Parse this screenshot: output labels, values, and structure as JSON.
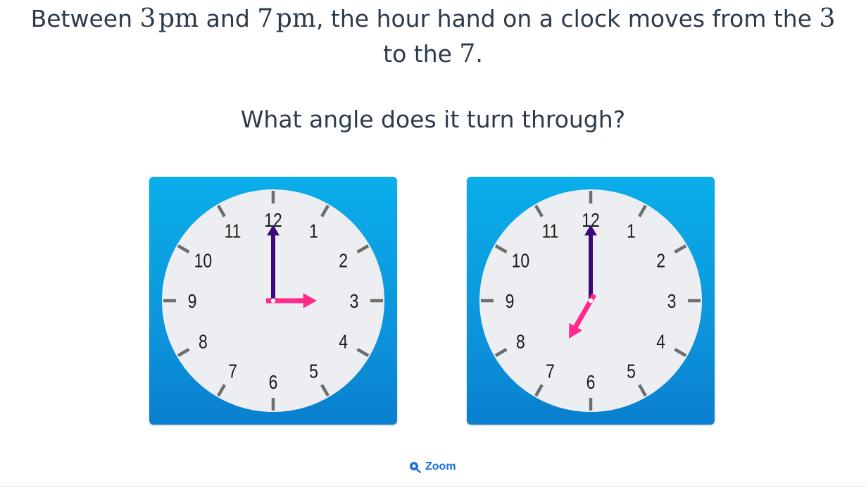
{
  "prompt": {
    "line1": {
      "part1": "Between ",
      "m1": "3",
      "m1_unit": "pm",
      "part2": " and ",
      "m2": "7",
      "m2_unit": "pm",
      "part3": ", the hour hand on a clock moves from the ",
      "m3": "3"
    },
    "line2": {
      "part1": "to the ",
      "m1": "7",
      "part2": "."
    },
    "question": "What angle does it turn through?"
  },
  "clocks": [
    {
      "name": "clock-3pm",
      "hour": 3,
      "minute": 0
    },
    {
      "name": "clock-7pm",
      "hour": 7,
      "minute": 0
    }
  ],
  "clock_numbers": [
    "12",
    "1",
    "2",
    "3",
    "4",
    "5",
    "6",
    "7",
    "8",
    "9",
    "10",
    "11"
  ],
  "colors": {
    "card_top": "#0aaeea",
    "card_bottom": "#0a7fcf",
    "face": "#eceef1",
    "ticks": "#6e6e6e",
    "minute_hand": "#3b0a7a",
    "hour_hand": "#ff2a8a",
    "link": "#1a6fe0"
  },
  "zoom": {
    "label": "Zoom",
    "icon": "zoom-in-icon"
  }
}
